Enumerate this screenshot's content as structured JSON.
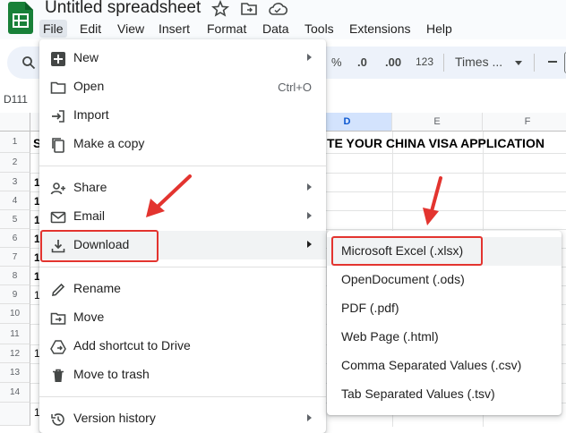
{
  "header": {
    "doc_title": "Untitled spreadsheet",
    "icons": [
      "sheets-logo-icon",
      "star-icon",
      "move-folder-icon",
      "cloud-saved-icon"
    ],
    "menus": [
      "File",
      "Edit",
      "View",
      "Insert",
      "Format",
      "Data",
      "Tools",
      "Extensions",
      "Help"
    ],
    "active_menu": "File"
  },
  "toolbar": {
    "percent": "%",
    "decrease_decimal": ".0",
    "increase_decimal": ".00",
    "number_format": "123",
    "font": "Times ..."
  },
  "formula": {
    "name_box": "D111"
  },
  "sheet": {
    "columns": [
      "D",
      "E",
      "F"
    ],
    "selected_column": "D",
    "rows": [
      "1",
      "2",
      "3",
      "4",
      "5",
      "6",
      "7",
      "8",
      "9",
      "10",
      "11",
      "12",
      "13",
      "14"
    ],
    "row1_text": "TE YOUR CHINA VISA APPLICATION",
    "row1_prefix": "S",
    "partial_digits": [
      "1",
      "1",
      "1",
      "1",
      "1",
      "1",
      "1",
      "1",
      "1"
    ]
  },
  "file_menu": {
    "items": [
      {
        "label": "New",
        "icon": "new-sheet-icon",
        "submenu": true
      },
      {
        "label": "Open",
        "icon": "folder-icon",
        "shortcut": "Ctrl+O"
      },
      {
        "label": "Import",
        "icon": "import-icon"
      },
      {
        "label": "Make a copy",
        "icon": "copy-icon"
      },
      {
        "label": "Share",
        "icon": "share-person-icon",
        "submenu": true
      },
      {
        "label": "Email",
        "icon": "email-icon",
        "submenu": true
      },
      {
        "label": "Download",
        "icon": "download-icon",
        "submenu": true
      },
      {
        "label": "Rename",
        "icon": "pencil-icon"
      },
      {
        "label": "Move",
        "icon": "move-folder-icon"
      },
      {
        "label": "Add shortcut to Drive",
        "icon": "drive-shortcut-icon"
      },
      {
        "label": "Move to trash",
        "icon": "trash-icon"
      },
      {
        "label": "Version history",
        "icon": "history-icon",
        "submenu": true
      }
    ]
  },
  "download_menu": {
    "items": [
      {
        "label": "Microsoft Excel (.xlsx)"
      },
      {
        "label": "OpenDocument (.ods)"
      },
      {
        "label": "PDF (.pdf)"
      },
      {
        "label": "Web Page (.html)"
      },
      {
        "label": "Comma Separated Values (.csv)"
      },
      {
        "label": "Tab Separated Values (.tsv)"
      }
    ]
  },
  "colors": {
    "annotation_red": "#e3342f",
    "sheets_green": "#188038",
    "selected_column_bg": "#d3e3fd"
  }
}
